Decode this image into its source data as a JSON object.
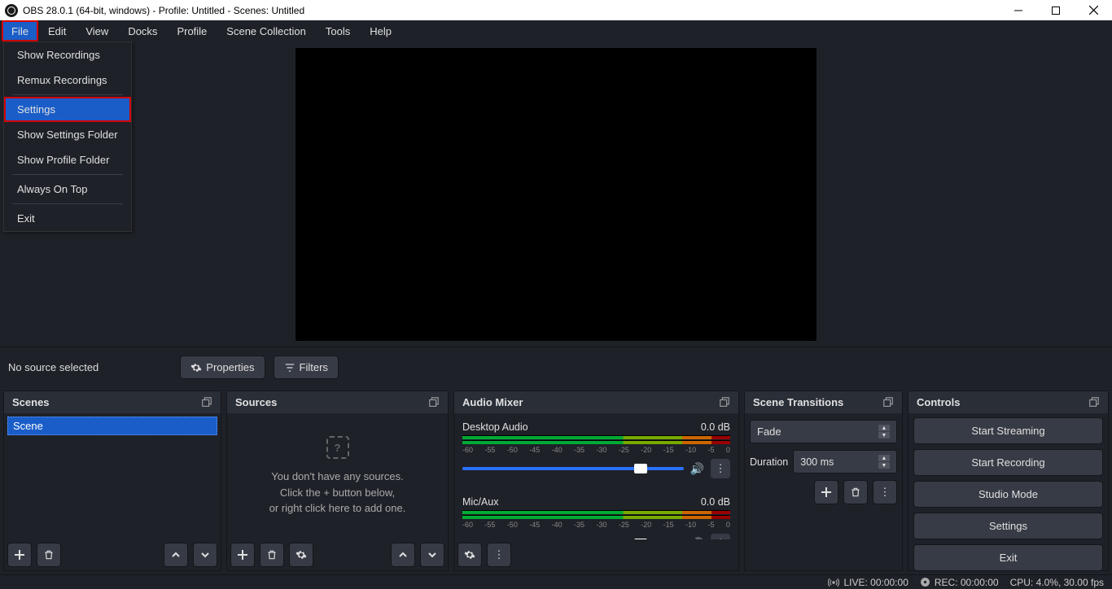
{
  "title": "OBS 28.0.1 (64-bit, windows) - Profile: Untitled - Scenes: Untitled",
  "menubar": {
    "file": "File",
    "edit": "Edit",
    "view": "View",
    "docks": "Docks",
    "profile": "Profile",
    "scene_collection": "Scene Collection",
    "tools": "Tools",
    "help": "Help"
  },
  "file_menu": {
    "show_recordings": "Show Recordings",
    "remux_recordings": "Remux Recordings",
    "settings": "Settings",
    "show_settings_folder": "Show Settings Folder",
    "show_profile_folder": "Show Profile Folder",
    "always_on_top": "Always On Top",
    "exit": "Exit"
  },
  "context": {
    "no_source": "No source selected",
    "properties": "Properties",
    "filters": "Filters"
  },
  "panels": {
    "scenes": "Scenes",
    "sources": "Sources",
    "audio_mixer": "Audio Mixer",
    "scene_transitions": "Scene Transitions",
    "controls": "Controls"
  },
  "scenes": {
    "item0": "Scene"
  },
  "sources_empty": {
    "line1": "You don't have any sources.",
    "line2": "Click the + button below,",
    "line3": "or right click here to add one."
  },
  "audio": {
    "ch0_name": "Desktop Audio",
    "ch0_db": "0.0 dB",
    "ch1_name": "Mic/Aux",
    "ch1_db": "0.0 dB",
    "ticks": [
      "-60",
      "-55",
      "-50",
      "-45",
      "-40",
      "-35",
      "-30",
      "-25",
      "-20",
      "-15",
      "-10",
      "-5",
      "0"
    ]
  },
  "transitions": {
    "selected": "Fade",
    "duration_label": "Duration",
    "duration_value": "300 ms"
  },
  "controls": {
    "start_streaming": "Start Streaming",
    "start_recording": "Start Recording",
    "studio_mode": "Studio Mode",
    "settings": "Settings",
    "exit": "Exit"
  },
  "status": {
    "live": "LIVE: 00:00:00",
    "rec": "REC: 00:00:00",
    "cpu": "CPU: 4.0%, 30.00 fps"
  }
}
